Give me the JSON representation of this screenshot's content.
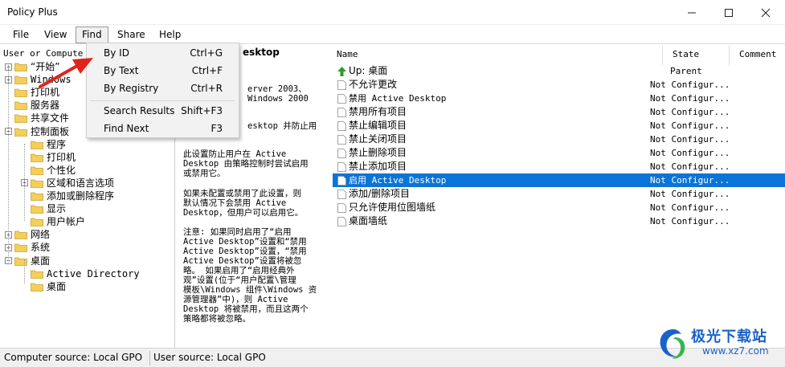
{
  "window": {
    "title": "Policy Plus",
    "controls": [
      "minimize-icon",
      "maximize-icon",
      "close-icon"
    ]
  },
  "menu": {
    "items": [
      "File",
      "View",
      "Find",
      "Share",
      "Help"
    ],
    "open": "Find"
  },
  "find_menu": {
    "items": [
      {
        "label": "By ID",
        "shortcut": "Ctrl+G"
      },
      {
        "label": "By Text",
        "shortcut": "Ctrl+F"
      },
      {
        "label": "By Registry",
        "shortcut": "Ctrl+R"
      },
      {
        "label": "Search Results",
        "shortcut": "Shift+F3"
      },
      {
        "label": "Find Next",
        "shortcut": "F3"
      }
    ]
  },
  "tree": {
    "header": "User or Compute",
    "nodes": [
      {
        "label": "“开始”",
        "expander": "+"
      },
      {
        "label": "Windows",
        "expander": "+"
      },
      {
        "label": "打印机",
        "expander": ""
      },
      {
        "label": "服务器",
        "expander": ""
      },
      {
        "label": "共享文件",
        "expander": ""
      },
      {
        "label": "控制面板",
        "expander": "−"
      },
      {
        "label": "程序",
        "expander": ""
      },
      {
        "label": "打印机",
        "expander": ""
      },
      {
        "label": "个性化",
        "expander": ""
      },
      {
        "label": "区域和语言选项",
        "expander": "+"
      },
      {
        "label": "添加或删除程序",
        "expander": ""
      },
      {
        "label": "显示",
        "expander": ""
      },
      {
        "label": "用户帐户",
        "expander": ""
      },
      {
        "label": "网络",
        "expander": "+"
      },
      {
        "label": "系统",
        "expander": "+"
      },
      {
        "label": "桌面",
        "expander": "−"
      },
      {
        "label": "Active Directory",
        "expander": ""
      },
      {
        "label": "桌面",
        "expander": ""
      }
    ]
  },
  "description": {
    "heading": "esktop",
    "lines_top": [
      "erver 2003、",
      "Windows 2000"
    ],
    "line_mid": "esktop 并防止用",
    "paragraphs": [
      "此设置防止用户在 Active\nDesktop 由策略控制时尝试启用\n或禁用它。",
      "如果未配置或禁用了此设置，则\n默认情况下会禁用 Active\nDesktop，但用户可以启用它。",
      "注意: 如果同时启用了“启用\nActive Desktop”设置和“禁用\nActive Desktop”设置，“禁用\nActive Desktop”设置将被忽\n略。 如果启用了“启用经典外\n观”设置(位于“用户配置\\管理\n模板\\Windows 组件\\Windows 资\n源管理器”中)，则 Active\nDesktop 将被禁用，而且这两个\n策略都将被忽略。"
    ]
  },
  "list": {
    "columns": [
      "Name",
      "State",
      "Comment"
    ],
    "up_row": {
      "name": "Up: 桌面",
      "state": "Parent"
    },
    "rows": [
      {
        "name": "不允许更改",
        "state": "Not Configur..."
      },
      {
        "name": "禁用 Active Desktop",
        "state": "Not Configur..."
      },
      {
        "name": "禁用所有项目",
        "state": "Not Configur..."
      },
      {
        "name": "禁止编辑项目",
        "state": "Not Configur..."
      },
      {
        "name": "禁止关闭项目",
        "state": "Not Configur..."
      },
      {
        "name": "禁止删除项目",
        "state": "Not Configur..."
      },
      {
        "name": "禁止添加项目",
        "state": "Not Configur..."
      },
      {
        "name": "启用 Active Desktop",
        "state": "Not Configur...",
        "selected": true
      },
      {
        "name": "添加/删除项目",
        "state": "Not Configur..."
      },
      {
        "name": "只允许使用位图墙纸",
        "state": "Not Configur..."
      },
      {
        "name": "桌面墙纸",
        "state": "Not Configur..."
      }
    ]
  },
  "status": {
    "computer_source": "Computer source:  Local GPO",
    "user_source": "User source:  Local GPO"
  },
  "watermark": {
    "text": "极光下载站",
    "url": "www.xz7.com"
  },
  "colors": {
    "selection": "#0a74d8",
    "folder": "#f4cf59",
    "arrow": "#e0241b",
    "up_arrow": "#2a9a2a"
  }
}
